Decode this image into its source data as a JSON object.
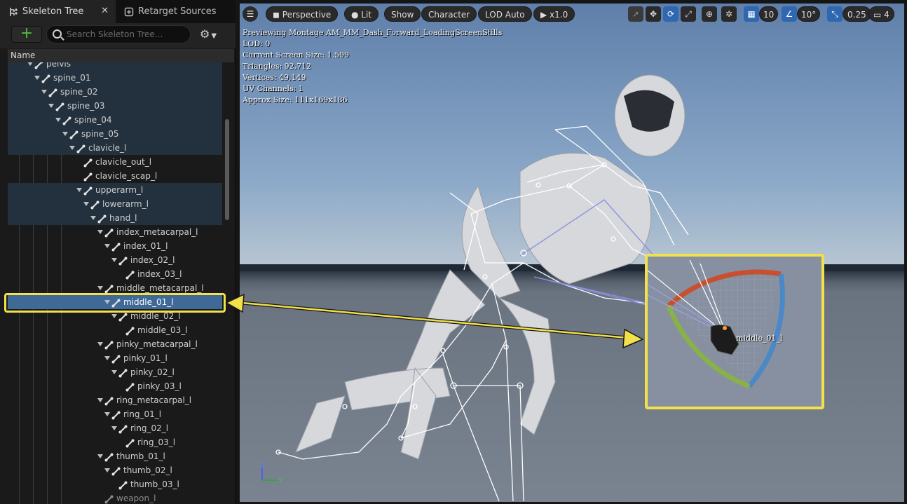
{
  "tabs": [
    {
      "label": "Skeleton Tree",
      "active": true,
      "icon": "skeleton-tree-icon"
    },
    {
      "label": "Retarget Sources",
      "active": false,
      "icon": "retarget-icon"
    }
  ],
  "toolbar": {
    "add_label": "+",
    "search_placeholder": "Search Skeleton Tree..."
  },
  "tree": {
    "column_header": "Name",
    "items": [
      {
        "label": "pelvis",
        "depth": 3,
        "state": "hl"
      },
      {
        "label": "spine_01",
        "depth": 4,
        "state": "hl"
      },
      {
        "label": "spine_02",
        "depth": 5,
        "state": "hl"
      },
      {
        "label": "spine_03",
        "depth": 6,
        "state": "hl"
      },
      {
        "label": "spine_04",
        "depth": 7,
        "state": "hl"
      },
      {
        "label": "spine_05",
        "depth": 8,
        "state": "hl"
      },
      {
        "label": "clavicle_l",
        "depth": 9,
        "state": "hl"
      },
      {
        "label": "clavicle_out_l",
        "depth": 10,
        "state": ""
      },
      {
        "label": "clavicle_scap_l",
        "depth": 10,
        "state": ""
      },
      {
        "label": "upperarm_l",
        "depth": 10,
        "state": "hl"
      },
      {
        "label": "lowerarm_l",
        "depth": 11,
        "state": "hl"
      },
      {
        "label": "hand_l",
        "depth": 12,
        "state": "hl"
      },
      {
        "label": "index_metacarpal_l",
        "depth": 13,
        "state": ""
      },
      {
        "label": "index_01_l",
        "depth": 14,
        "state": ""
      },
      {
        "label": "index_02_l",
        "depth": 15,
        "state": ""
      },
      {
        "label": "index_03_l",
        "depth": 16,
        "state": ""
      },
      {
        "label": "middle_metacarpal_l",
        "depth": 13,
        "state": ""
      },
      {
        "label": "middle_01_l",
        "depth": 14,
        "state": "sel"
      },
      {
        "label": "middle_02_l",
        "depth": 15,
        "state": ""
      },
      {
        "label": "middle_03_l",
        "depth": 16,
        "state": ""
      },
      {
        "label": "pinky_metacarpal_l",
        "depth": 13,
        "state": ""
      },
      {
        "label": "pinky_01_l",
        "depth": 14,
        "state": ""
      },
      {
        "label": "pinky_02_l",
        "depth": 15,
        "state": ""
      },
      {
        "label": "pinky_03_l",
        "depth": 16,
        "state": ""
      },
      {
        "label": "ring_metacarpal_l",
        "depth": 13,
        "state": ""
      },
      {
        "label": "ring_01_l",
        "depth": 14,
        "state": ""
      },
      {
        "label": "ring_02_l",
        "depth": 15,
        "state": ""
      },
      {
        "label": "ring_03_l",
        "depth": 16,
        "state": ""
      },
      {
        "label": "thumb_01_l",
        "depth": 13,
        "state": ""
      },
      {
        "label": "thumb_02_l",
        "depth": 14,
        "state": ""
      },
      {
        "label": "thumb_03_l",
        "depth": 15,
        "state": ""
      },
      {
        "label": "weapon_l",
        "depth": 13,
        "state": "dim"
      }
    ]
  },
  "viewport": {
    "buttons": {
      "perspective": "Perspective",
      "lit": "Lit",
      "show": "Show",
      "character": "Character",
      "lod": "LOD Auto",
      "speed": "x1.0",
      "grid_value": "10",
      "angle_value": "10°",
      "scale_value": "0.25",
      "camera_value": "4"
    },
    "stats": [
      "Previewing Montage AM_MM_Dash_Forward_LoadingScreenStills",
      "LOD: 0",
      "Current Screen Size: 1.599",
      "Triangles: 92,712",
      "Vertices: 49,149",
      "UV Channels: 1",
      "Approx Size: 111x169x186"
    ],
    "bone_label": "middle_01_l",
    "axis_z": "Z",
    "axis_y": "Y"
  },
  "colors": {
    "callout": "#f2e14a",
    "selection": "#3f6a98",
    "accent": "#2f68b0"
  }
}
